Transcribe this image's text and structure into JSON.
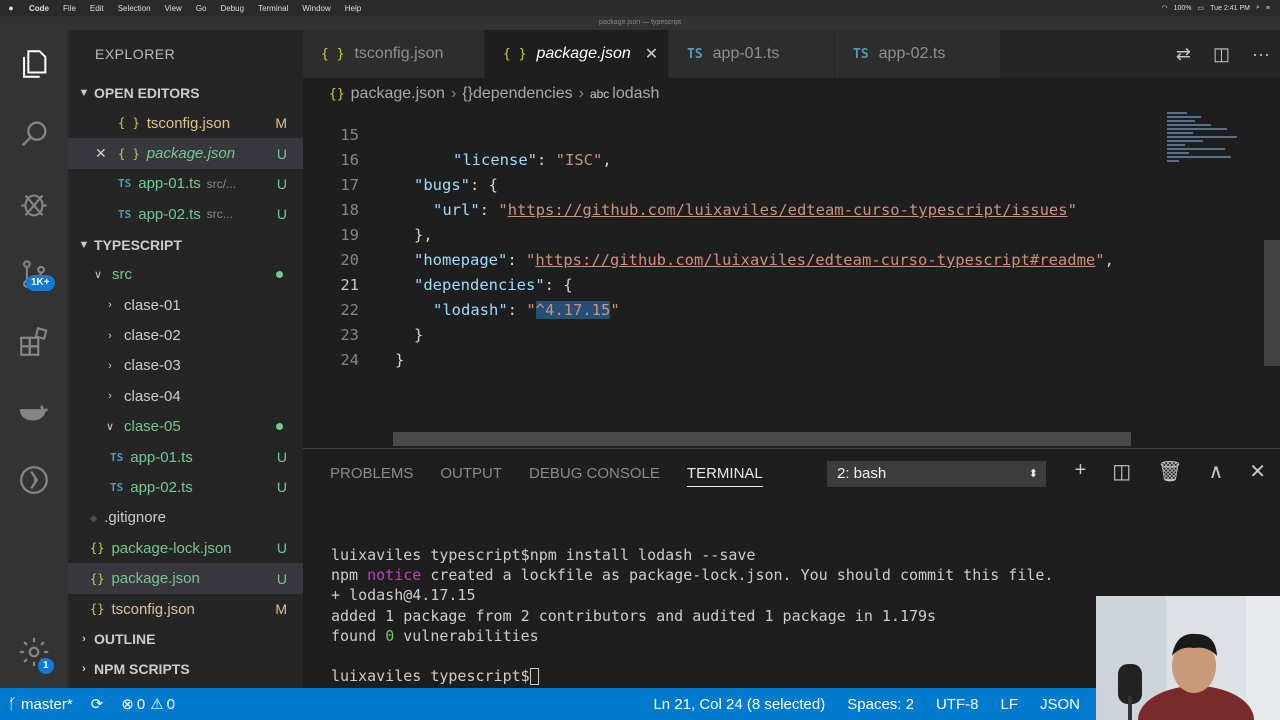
{
  "menubar": {
    "items": [
      "Code",
      "File",
      "Edit",
      "Selection",
      "View",
      "Go",
      "Debug",
      "Terminal",
      "Window",
      "Help"
    ],
    "battery": "100%",
    "clock": "Tue 2:41 PM"
  },
  "window_title": "package.json — typescript",
  "activity": {
    "scm_badge": "1K+",
    "settings_badge": "1"
  },
  "sidebar": {
    "title": "EXPLORER",
    "open_editors": {
      "title": "OPEN EDITORS",
      "items": [
        {
          "name": "tsconfig.json",
          "status": "M",
          "icon": "{ }",
          "close": ""
        },
        {
          "name": "package.json",
          "status": "U",
          "icon": "{ }",
          "close": "✕"
        },
        {
          "name": "app-01.ts",
          "dir": "src/...",
          "status": "U",
          "icon": "TS"
        },
        {
          "name": "app-02.ts",
          "dir": "src...",
          "status": "U",
          "icon": "TS"
        }
      ]
    },
    "project": {
      "title": "TYPESCRIPT",
      "items": [
        {
          "name": "src"
        },
        {
          "name": "clase-01"
        },
        {
          "name": "clase-02"
        },
        {
          "name": "clase-03"
        },
        {
          "name": "clase-04"
        },
        {
          "name": "clase-05"
        },
        {
          "name": "app-01.ts",
          "status": "U"
        },
        {
          "name": "app-02.ts",
          "status": "U"
        },
        {
          "name": ".gitignore"
        },
        {
          "name": "package-lock.json",
          "status": "U"
        },
        {
          "name": "package.json",
          "status": "U"
        },
        {
          "name": "tsconfig.json",
          "status": "M"
        }
      ]
    },
    "outline": "OUTLINE",
    "npm_scripts": "NPM SCRIPTS"
  },
  "tabs": [
    {
      "icon": "{ }",
      "label": "tsconfig.json"
    },
    {
      "icon": "{ }",
      "label": "package.json",
      "close": "✕"
    },
    {
      "icon": "TS",
      "label": "app-01.ts"
    },
    {
      "icon": "TS",
      "label": "app-02.ts"
    }
  ],
  "breadcrumb": {
    "file": "package.json",
    "sep": "›",
    "node1": "{}dependencies",
    "node2": "lodash"
  },
  "editor": {
    "lines": [
      {
        "n": "15",
        "t": "\"license\": \"ISC\","
      },
      {
        "n": "16",
        "t": "\"bugs\": {"
      },
      {
        "n": "17",
        "t": "\"url\": \"https://github.com/luixaviles/edteam-curso-typescript/issues\""
      },
      {
        "n": "18",
        "t": "},"
      },
      {
        "n": "19",
        "t": "\"homepage\": \"https://github.com/luixaviles/edteam-curso-typescript#readme\","
      },
      {
        "n": "20",
        "t": "\"dependencies\": {"
      },
      {
        "n": "21",
        "t": "\"lodash\": \"^4.17.15\""
      },
      {
        "n": "22",
        "t": "}"
      },
      {
        "n": "23",
        "t": "}"
      },
      {
        "n": "24",
        "t": ""
      }
    ],
    "parts": {
      "license_key": "\"license\"",
      "license_val": "\"ISC\"",
      "bugs_key": "\"bugs\"",
      "url_key": "\"url\"",
      "url_val": "https://github.com/luixaviles/edteam-curso-typescript/issues",
      "homepage_key": "\"homepage\"",
      "homepage_val": "https://github.com/luixaviles/edteam-curso-typescript#readme",
      "deps_key": "\"dependencies\"",
      "lodash_key": "\"lodash\"",
      "lodash_val": "^4.17.15"
    }
  },
  "panel": {
    "tabs": [
      "PROBLEMS",
      "OUTPUT",
      "DEBUG CONSOLE",
      "TERMINAL"
    ],
    "terminal_select": "2: bash",
    "terminal": {
      "prompt": "luixaviles typescript$",
      "cmd": "npm install lodash --save",
      "npm": "npm",
      "notice": "notice",
      "notice_text": " created a lockfile as package-lock.json. You should commit this file.",
      "line3": "+ lodash@4.17.15",
      "line4": "added 1 package from 2 contributors and audited 1 package in 1.179s",
      "line5a": "found ",
      "line5b": "0",
      "line5c": " vulnerabilities"
    }
  },
  "status": {
    "branch": "master*",
    "errors": "0",
    "warnings": "0",
    "position": "Ln 21, Col 24 (8 selected)",
    "spaces": "Spaces: 2",
    "encoding": "UTF-8",
    "eol": "LF",
    "language": "JSON"
  }
}
